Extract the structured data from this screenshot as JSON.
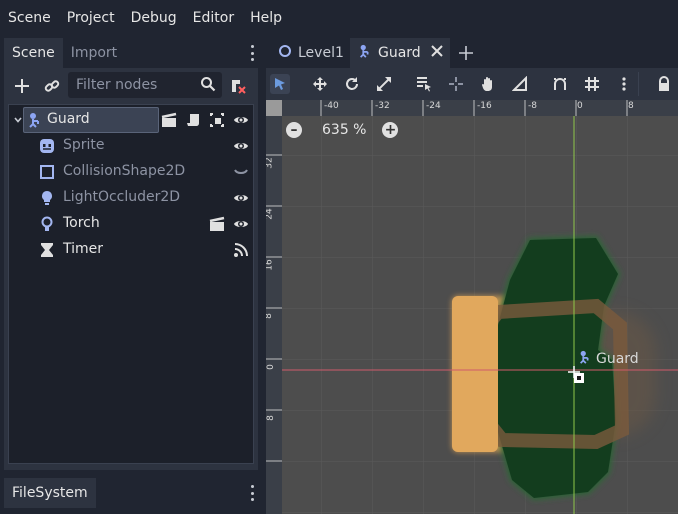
{
  "menu": [
    "Scene",
    "Project",
    "Debug",
    "Editor",
    "Help"
  ],
  "left_dock": {
    "tabs": [
      "Scene",
      "Import"
    ],
    "filter_placeholder": "Filter nodes",
    "tree": [
      {
        "name": "Guard",
        "dim": false,
        "selected": true
      },
      {
        "name": "Sprite",
        "dim": true
      },
      {
        "name": "CollisionShape2D",
        "dim": true
      },
      {
        "name": "LightOccluder2D",
        "dim": true
      },
      {
        "name": "Torch",
        "dim": false
      },
      {
        "name": "Timer",
        "dim": false
      }
    ],
    "bottom_tab": "FileSystem"
  },
  "main": {
    "tabs": [
      "Level1",
      "Guard"
    ],
    "zoom": "635 %",
    "node_label": "Guard",
    "ruler_h": [
      "-40",
      "-32",
      "-24",
      "-16",
      "-8",
      "0",
      "8"
    ],
    "ruler_v": [
      "32",
      "24",
      "16",
      "8",
      "0",
      "8"
    ]
  },
  "colors": {
    "accent": "#6c9bdf",
    "axis_x": "#d05a6a",
    "axis_y": "#8fc84a",
    "selection": "#3b4354"
  }
}
